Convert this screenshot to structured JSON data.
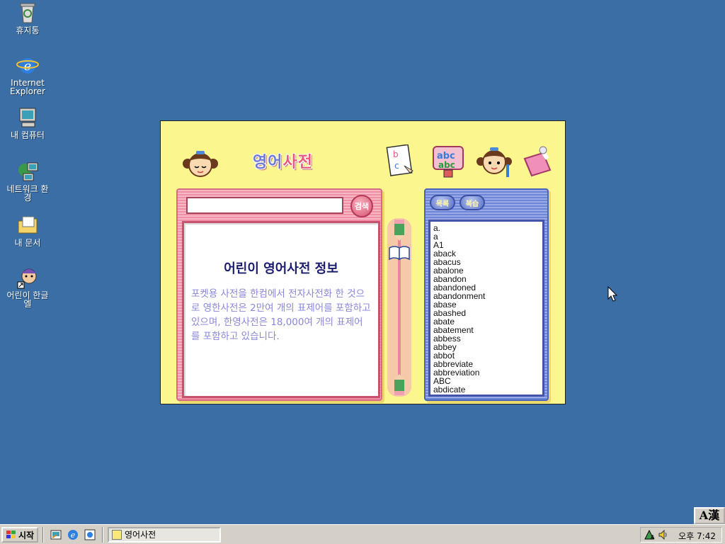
{
  "desktop": {
    "icons": [
      {
        "label": "휴지통",
        "icon": "recycle-bin-icon"
      },
      {
        "label": "Internet Explorer",
        "icon": "internet-explorer-icon"
      },
      {
        "label": "내 컴퓨터",
        "icon": "my-computer-icon"
      },
      {
        "label": "네트워크 환경",
        "icon": "network-neighborhood-icon"
      },
      {
        "label": "내 문서",
        "icon": "my-documents-icon"
      },
      {
        "label": "어린이 한글 엘",
        "icon": "kids-hangul-icon"
      }
    ]
  },
  "app": {
    "title_part1": "영어",
    "title_part2": "사전",
    "search": {
      "value": "",
      "button_label": "검색"
    },
    "info": {
      "title": "어린이 영어사전 정보",
      "text": "포켓용 사전을 한컴에서 전자사전화 한 것으로 영한사전은 2만여 개의 표제어를 포함하고 있으며, 한영사전은 18,000여 개의 표제어를 포함하고 있습니다."
    },
    "tabs": {
      "list": "목록",
      "review": "복습"
    },
    "words": [
      "a.",
      "a",
      "A1",
      "aback",
      "abacus",
      "abalone",
      "abandon",
      "abandoned",
      "abandonment",
      "abase",
      "abashed",
      "abate",
      "abatement",
      "abbess",
      "abbey",
      "abbot",
      "abbreviate",
      "abbreviation",
      "ABC",
      "abdicate"
    ]
  },
  "taskbar": {
    "start_label": "시작",
    "task_label": "영어사전",
    "clock": "오후 7:42",
    "ime_label": "A漢"
  },
  "colors": {
    "desktop": "#3a6ea5",
    "app_bg": "#fcf68f",
    "pink_panel": "#f08fa3",
    "blue_panel": "#6d85d6"
  }
}
